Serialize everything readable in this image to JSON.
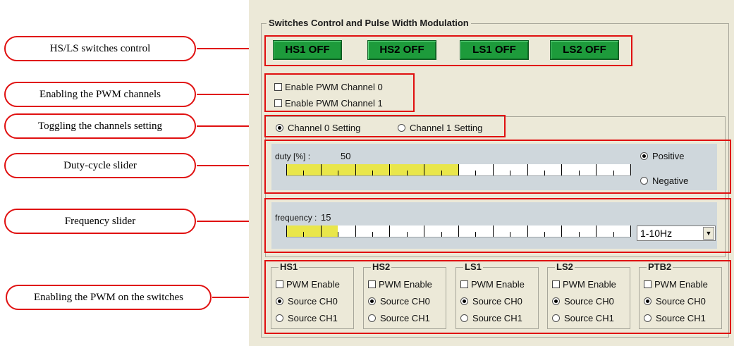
{
  "callouts": {
    "switches": "HS/LS switches control",
    "enable_pwm": "Enabling the PWM channels",
    "toggle": "Toggling the channels setting",
    "duty": "Duty-cycle slider",
    "frequency": "Frequency slider",
    "pwm_switches": "Enabling the PWM on the switches"
  },
  "group": {
    "title": "Switches Control and Pulse Width Modulation"
  },
  "buttons": [
    "HS1 OFF",
    "HS2 OFF",
    "LS1 OFF",
    "LS2 OFF"
  ],
  "pwm_channels": [
    {
      "label": "Enable PWM Channel 0",
      "checked": false
    },
    {
      "label": "Enable PWM Channel 1",
      "checked": false
    }
  ],
  "channel_setting": {
    "options": [
      "Channel 0 Setting",
      "Channel 1 Setting"
    ],
    "selected": "Channel 0 Setting"
  },
  "duty": {
    "label": "duty [%] :",
    "value": "50",
    "fill_fraction": 0.5,
    "polarity": {
      "options": [
        "Positive",
        "Negative"
      ],
      "selected": "Positive"
    }
  },
  "frequency": {
    "label": "frequency :",
    "value": "15",
    "fill_fraction": 0.15,
    "range": {
      "selected": "1-10Hz"
    }
  },
  "switches": [
    {
      "title": "HS1",
      "pwm_enable": "PWM Enable",
      "source0": "Source CH0",
      "source1": "Source CH1",
      "selected": "Source CH0"
    },
    {
      "title": "HS2",
      "pwm_enable": "PWM Enable",
      "source0": "Source CH0",
      "source1": "Source CH1",
      "selected": "Source CH0"
    },
    {
      "title": "LS1",
      "pwm_enable": "PWM Enable",
      "source0": "Source CH0",
      "source1": "Source CH1",
      "selected": "Source CH0"
    },
    {
      "title": "LS2",
      "pwm_enable": "PWM Enable",
      "source0": "Source CH0",
      "source1": "Source CH1",
      "selected": "Source CH0"
    },
    {
      "title": "PTB2",
      "pwm_enable": "PWM Enable",
      "source0": "Source CH0",
      "source1": "Source CH1",
      "selected": "Source CH0"
    }
  ],
  "colors": {
    "accent_red": "#e01010",
    "button_green": "#1d9b3b",
    "slider_fill": "#e9e64a",
    "panel_bg": "#ece9d8"
  }
}
